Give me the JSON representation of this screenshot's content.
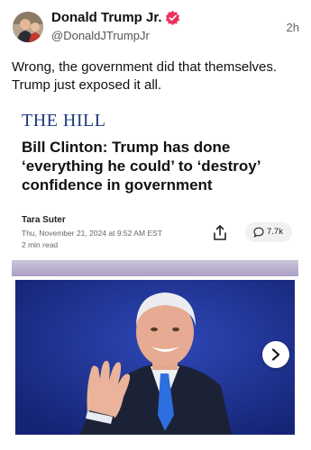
{
  "post": {
    "author_name": "Donald Trump Jr.",
    "handle": "@DonaldJTrumpJr",
    "time": "2h",
    "verified_icon": "verified-badge-icon",
    "text": "Wrong, the government did that themselves. Trump just exposed it all."
  },
  "article": {
    "publisher": "THE HILL",
    "headline": "Bill Clinton: Trump has done ‘everything he could’ to ‘destroy’ confidence in government",
    "author": "Tara Suter",
    "date": "Thu, November 21, 2024 at 9:52 AM EST",
    "read_time": "2 min read",
    "share_icon": "share-icon",
    "comment_icon": "comment-bubble-icon",
    "comment_count": "7.7k",
    "image_alt": "article-photo",
    "next_icon": "chevron-right-icon"
  },
  "colors": {
    "verified": "#e8315a",
    "publisher": "#1d3a7a",
    "photo_background": "#1d2f8c",
    "card_bar": "#ab9fc6"
  }
}
